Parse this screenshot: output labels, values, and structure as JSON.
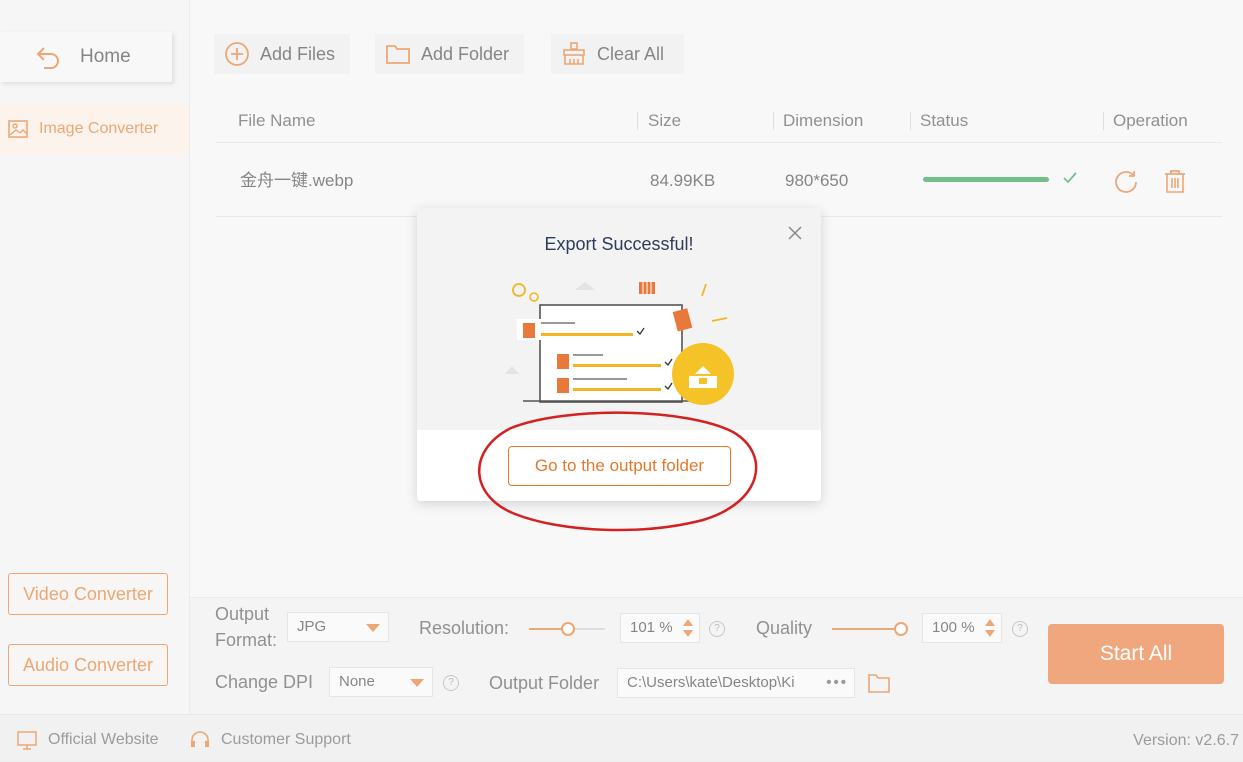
{
  "sidebar": {
    "home_label": "Home",
    "active_item_label": "Image Converter",
    "video_button_label": "Video Converter",
    "audio_button_label": "Audio Converter"
  },
  "toolbar": {
    "add_files_label": "Add Files",
    "add_folder_label": "Add Folder",
    "clear_all_label": "Clear All"
  },
  "table": {
    "headers": [
      "File Name",
      "Size",
      "Dimension",
      "Status",
      "Operation"
    ],
    "rows": [
      {
        "file_name": "金舟一键.webp",
        "size": "84.99KB",
        "dimension": "980*650",
        "progress": 1.0
      }
    ]
  },
  "settings": {
    "output_format_label_1": "Output",
    "output_format_label_2": "Format:",
    "output_format_value": "JPG",
    "resolution_label": "Resolution:",
    "resolution_value": "101 %",
    "quality_label": "Quality",
    "quality_value": "100 %",
    "dpi_label": "Change DPI",
    "dpi_value": "None",
    "output_folder_label": "Output Folder",
    "output_folder_value": "C:\\Users\\kate\\Desktop\\Ki",
    "more_dots": "•••",
    "help_glyph": "?",
    "start_label": "Start All"
  },
  "footer": {
    "website_label": "Official Website",
    "support_label": "Customer Support",
    "version_label": "Version: v2.6.7"
  },
  "modal": {
    "title": "Export Successful!",
    "button_label": "Go to the output folder"
  },
  "colors": {
    "accent": "#e3782b",
    "success": "#2a9b4e",
    "start_button": "#e8793a",
    "annotation": "#d32020"
  }
}
